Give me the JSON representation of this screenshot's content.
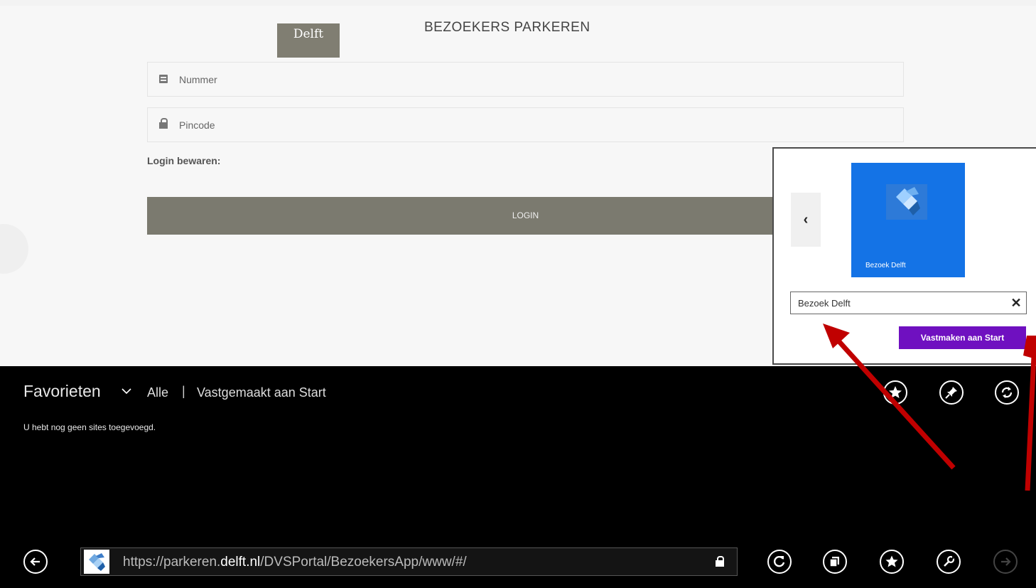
{
  "site": {
    "logo_text": "Delft",
    "title": "BEZOEKERS PARKEREN",
    "number_placeholder": "Nummer",
    "pincode_placeholder": "Pincode",
    "remember_label": "Login bewaren:",
    "login_button": "LOGIN"
  },
  "pin_flyout": {
    "tile_label": "Bezoek Delft",
    "name_value": "Bezoek Delft",
    "clear_symbol": "✕",
    "prev_symbol": "‹",
    "pin_button": "Vastmaken aan Start",
    "tile_color": "#1473e6",
    "button_color": "#6f10c0"
  },
  "favorites": {
    "title": "Favorieten",
    "tab_all": "Alle",
    "separator": "|",
    "tab_pinned": "Vastgemaakt aan Start",
    "empty_message": "U hebt nog geen sites toegevoegd."
  },
  "top_icons": [
    "add-favorite-icon",
    "pin-icon",
    "sync-icon"
  ],
  "address_bar": {
    "url_prefix": "https://parkeren.",
    "url_domain": "delft.nl",
    "url_path": "/DVSPortal/BezoekersApp/www/#/"
  },
  "nav_icons": [
    "back-icon",
    "refresh-icon",
    "tabs-icon",
    "favorites-icon",
    "tools-icon",
    "forward-icon"
  ],
  "annotation_color": "#c00000"
}
